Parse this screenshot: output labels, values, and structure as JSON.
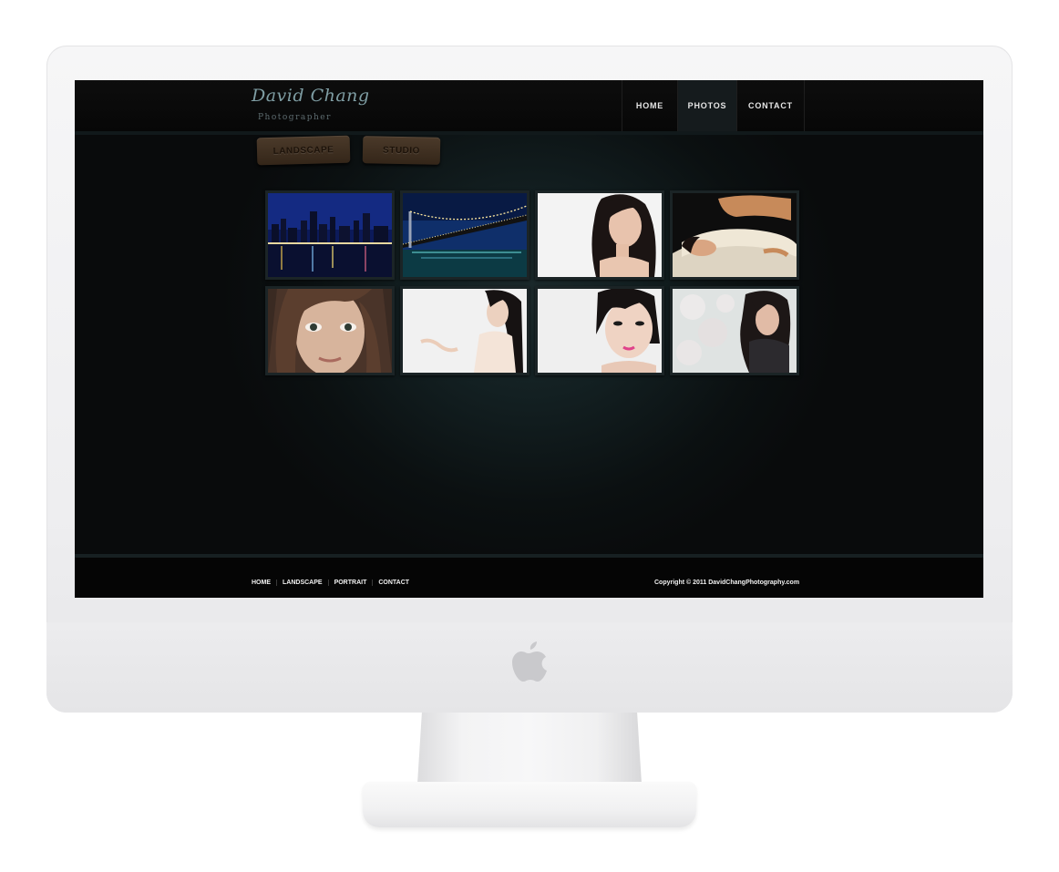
{
  "brand": {
    "name": "David Chang",
    "tagline": "Photographer"
  },
  "nav": {
    "items": [
      {
        "label": "HOME"
      },
      {
        "label": "PHOTOS"
      },
      {
        "label": "CONTACT"
      }
    ],
    "active": "PHOTOS"
  },
  "categories": {
    "tabs": [
      {
        "label": "LANDSCAPE"
      },
      {
        "label": "STUDIO"
      }
    ]
  },
  "gallery": {
    "photos": [
      {
        "subject": "city skyline at night"
      },
      {
        "subject": "bridge at night"
      },
      {
        "subject": "studio portrait"
      },
      {
        "subject": "reclining portrait"
      },
      {
        "subject": "close-up portrait"
      },
      {
        "subject": "studio portrait"
      },
      {
        "subject": "studio portrait"
      },
      {
        "subject": "portrait with floral backdrop"
      }
    ]
  },
  "footer": {
    "links": [
      {
        "label": "HOME"
      },
      {
        "label": "LANDSCAPE"
      },
      {
        "label": "PORTRAIT"
      },
      {
        "label": "CONTACT"
      }
    ],
    "copyright": "Copyright © 2011 DavidChangPhotography.com"
  },
  "colors": {
    "page_background": "#0d1012",
    "accent_teal": "#7f9ea4",
    "tab_wood": "#4b3a2a",
    "nav_text": "#e6e6e6"
  },
  "icons": {
    "device_logo": "apple-logo-icon"
  }
}
